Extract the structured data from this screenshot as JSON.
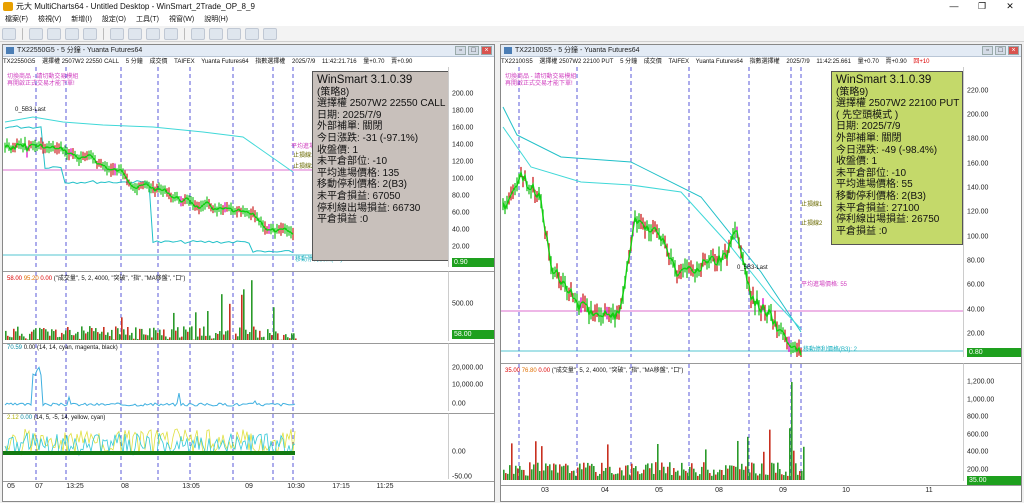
{
  "app": {
    "title": "元大 MultiCharts64 - Untitled Desktop - WinSmart_2Trade_OP_8_9",
    "window_controls": [
      "—",
      "❐",
      "✕"
    ]
  },
  "menu": [
    "檔案(F)",
    "檢視(V)",
    "新增(I)",
    "設定(O)",
    "工具(T)",
    "視窗(W)",
    "說明(H)"
  ],
  "left_chart": {
    "window_title": "TX22550G5 - 5 分鐘 - Yuanta Futures64",
    "info_items": [
      "TX22550G5",
      "選擇權 2507W2 22550 CALL",
      "5 分鐘",
      "成交價",
      "TAIFEX",
      "Yuanta Futures64",
      "指數選擇權",
      "2025/7/9",
      "11:42:21.716",
      "量+0.70",
      "賣+0.90"
    ],
    "signal_labels": [
      "切換商品 - 請切動交易模組",
      "再開啟正式交易才能下單!"
    ],
    "info_box": [
      "WinSmart 3.1.0.39",
      "(策略8)",
      "選擇權 2507W2 22550 CALL",
      "日期: 2025/7/9",
      "外部補單: 關閉",
      "今日漲跌: -31 (-97.1%)",
      "收盤價: 1",
      "未平倉部位: -10",
      "平均進場價格: 135",
      "移動停利價格: 2(B3)",
      "未平倉損益: 67050",
      "停利線出場損益: 66730",
      "平倉損益 :0"
    ],
    "price_axis": [
      "200.00",
      "180.00",
      "160.00",
      "140.00",
      "120.00",
      "100.00",
      "80.00",
      "60.00",
      "40.00",
      "20.00",
      "0.00"
    ],
    "price_tag": "0.90",
    "tags": {
      "entry": "平均進場價",
      "stop1": "止損線1",
      "stop2": "止損線2",
      "trail": "移動停利價格(B3): 2",
      "last": "0_5B3-Last"
    },
    "volume_header": {
      "a": "58.00",
      "b": "95.20",
      "c": "0.00",
      "text": "(\"成交量\", 5, 2, 4000, \"突破\", \"指\", \"MA移盤\", \"口\")"
    },
    "volume_axis": [
      "500.00",
      "58.00"
    ],
    "ind2_header": {
      "a": "70.59",
      "b": "0.00",
      "text": "(14, 14, cyan, magenta, black)"
    },
    "ind2_axis": [
      "20,000.00",
      "10,000.00",
      "0.00"
    ],
    "ind3_header": {
      "a": "2.12",
      "b": "0.00",
      "text": "(14, 5, -5, 14, yellow, cyan)"
    },
    "ind3_axis": [
      "0.00",
      "-50.00"
    ],
    "time_axis": [
      "05",
      "07",
      "13:25",
      "08",
      "13:05",
      "09",
      "10:30",
      "17:15",
      "11:25"
    ]
  },
  "right_chart": {
    "window_title": "TX22100S5 - 5 分鐘 - Yuanta Futures64",
    "info_items": [
      "TX22100S5",
      "選擇權 2507W2 22100 PUT",
      "5 分鐘",
      "成交價",
      "TAIFEX",
      "Yuanta Futures64",
      "指數選擇權",
      "2025/7/9",
      "11:42:25.661",
      "量+0.70",
      "賣+0.90",
      "回+10"
    ],
    "signal_labels": [
      "切換商品 - 請切動交易模組",
      "再開啟正式交易才能下單!"
    ],
    "info_box": [
      "WinSmart 3.1.0.39",
      "(策略9)",
      "選擇權 2507W2 22100 PUT",
      "( 先空頭模式 )",
      "日期: 2025/7/9",
      "外部補單: 關閉",
      "今日漲跌: -49 (-98.4%)",
      "收盤價: 1",
      "未平倉部位: -10",
      "平均進場價格: 55",
      "移動停利價格: 2(B3)",
      "未平倉損益: 27100",
      "停利線出場損益: 26750",
      "平倉損益 :0"
    ],
    "price_axis": [
      "220.00",
      "200.00",
      "180.00",
      "160.00",
      "140.00",
      "120.00",
      "100.00",
      "80.00",
      "60.00",
      "40.00",
      "20.00"
    ],
    "price_tag": "0.80",
    "tags": {
      "entry": "平均進場價格: 55",
      "stop1": "止損線1",
      "stop2": "止損線2",
      "trail": "移動停利價格(B3): 2",
      "last": "0_5B3-Last"
    },
    "volume_header": {
      "a": "35.00",
      "b": "76.80",
      "c": "0.00",
      "text": "(\"成交量\", 5, 2, 4000, \"突破\", \"指\", \"MA移盤\", \"口\")"
    },
    "volume_axis": [
      "1,200.00",
      "1,000.00",
      "800.00",
      "600.00",
      "400.00",
      "200.00",
      "35.00"
    ],
    "time_axis": [
      "03",
      "04",
      "05",
      "08",
      "09",
      "10",
      "11"
    ]
  }
}
